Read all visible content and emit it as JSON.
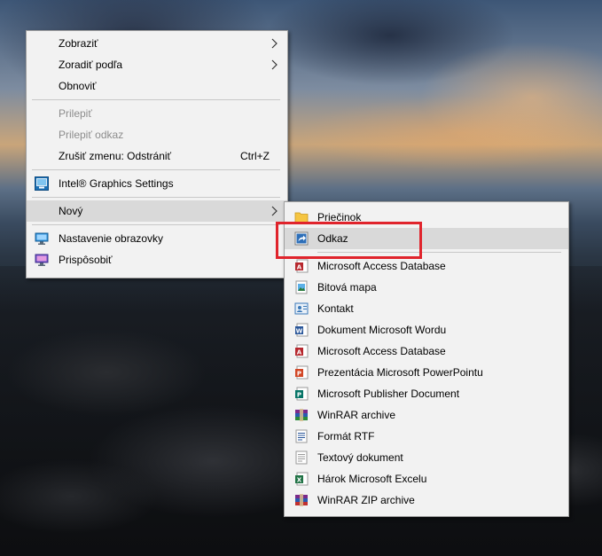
{
  "main_menu": {
    "items": [
      {
        "label": "Zobraziť",
        "enabled": true,
        "submenu": true
      },
      {
        "label": "Zoradiť podľa",
        "enabled": true,
        "submenu": true
      },
      {
        "label": "Obnoviť",
        "enabled": true
      },
      {
        "label": "Prilepiť",
        "enabled": false
      },
      {
        "label": "Prilepiť odkaz",
        "enabled": false
      },
      {
        "label": "Zrušiť zmenu: Odstrániť",
        "enabled": true,
        "shortcut": "Ctrl+Z"
      },
      {
        "label": "Intel® Graphics Settings",
        "enabled": true,
        "icon": "intel-graphics-icon"
      },
      {
        "label": "Nový",
        "enabled": true,
        "submenu": true,
        "state": "hovered"
      },
      {
        "label": "Nastavenie obrazovky",
        "enabled": true,
        "icon": "display-settings-icon"
      },
      {
        "label": "Prispôsobiť",
        "enabled": true,
        "icon": "personalize-icon"
      }
    ]
  },
  "new_submenu": {
    "items": [
      {
        "label": "Priečinok",
        "icon": "folder-icon"
      },
      {
        "label": "Odkaz",
        "icon": "shortcut-icon",
        "state": "hovered"
      },
      {
        "label": "Microsoft Access Database",
        "icon": "access-icon"
      },
      {
        "label": "Bitová mapa",
        "icon": "bitmap-icon"
      },
      {
        "label": "Kontakt",
        "icon": "contact-icon"
      },
      {
        "label": "Dokument Microsoft Wordu",
        "icon": "word-icon"
      },
      {
        "label": "Microsoft Access Database",
        "icon": "access-icon"
      },
      {
        "label": "Prezentácia Microsoft PowerPointu",
        "icon": "powerpoint-icon"
      },
      {
        "label": "Microsoft Publisher Document",
        "icon": "publisher-icon"
      },
      {
        "label": "WinRAR archive",
        "icon": "winrar-icon"
      },
      {
        "label": "Formát RTF",
        "icon": "rtf-icon"
      },
      {
        "label": "Textový dokument",
        "icon": "text-document-icon"
      },
      {
        "label": "Hárok Microsoft Excelu",
        "icon": "excel-icon"
      },
      {
        "label": "WinRAR ZIP archive",
        "icon": "winrar-zip-icon"
      }
    ]
  },
  "colors": {
    "menu_background": "#f2f2f2",
    "hover_background": "#d9d9d9",
    "disabled_text": "#8c8c8c",
    "highlight_border": "#e0242c"
  }
}
